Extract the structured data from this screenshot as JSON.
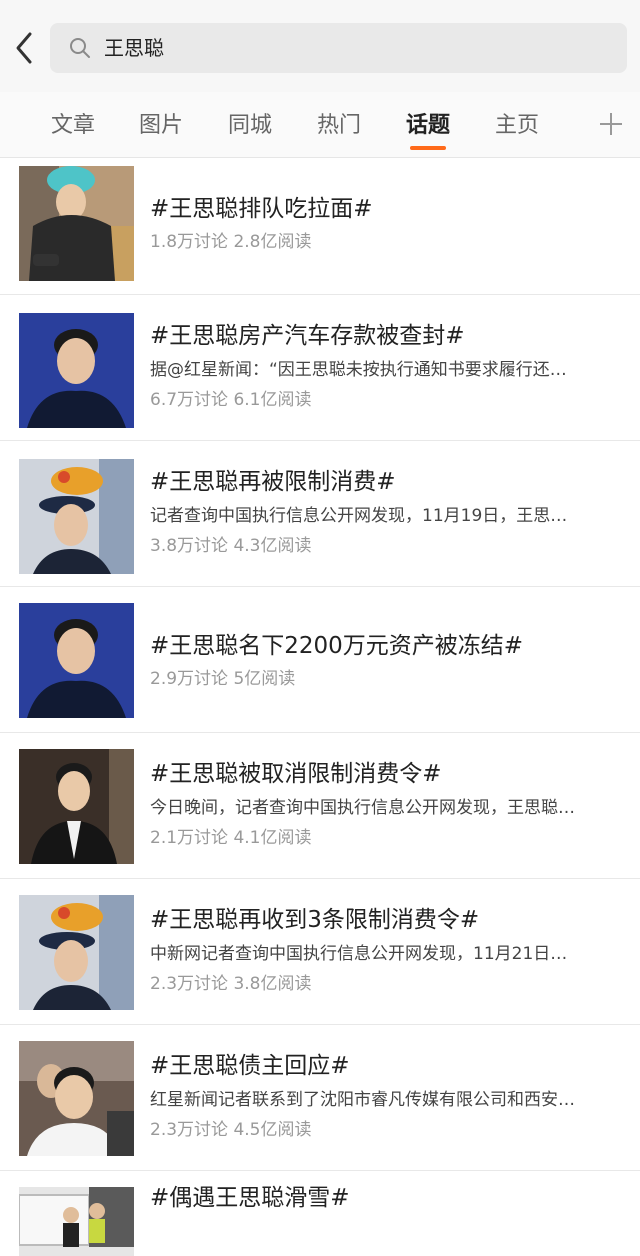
{
  "header": {
    "back_icon": "back-arrow-icon",
    "search_icon": "search-icon",
    "search_query": "王思聪"
  },
  "tabs": [
    {
      "label": "文章",
      "active": false
    },
    {
      "label": "图片",
      "active": false
    },
    {
      "label": "同城",
      "active": false
    },
    {
      "label": "热门",
      "active": false
    },
    {
      "label": "话题",
      "active": true
    },
    {
      "label": "主页",
      "active": false
    }
  ],
  "add_tab_icon": "plus-icon",
  "accent_color": "#ff6a1a",
  "topics": [
    {
      "title": "#王思聪排队吃拉面#",
      "desc": "",
      "stats": "1.8万讨论 2.8亿阅读"
    },
    {
      "title": "#王思聪房产汽车存款被查封#",
      "desc": "据@红星新闻：“因王思聪未按执行通知书要求履行还…",
      "stats": "6.7万讨论 6.1亿阅读"
    },
    {
      "title": "#王思聪再被限制消费#",
      "desc": "记者查询中国执行信息公开网发现，11月19日，王思…",
      "stats": "3.8万讨论 4.3亿阅读"
    },
    {
      "title": "#王思聪名下2200万元资产被冻结#",
      "desc": "",
      "stats": "2.9万讨论 5亿阅读"
    },
    {
      "title": "#王思聪被取消限制消费令#",
      "desc": "今日晚间，记者查询中国执行信息公开网发现，王思聪…",
      "stats": "2.1万讨论 4.1亿阅读"
    },
    {
      "title": "#王思聪再收到3条限制消费令#",
      "desc": "中新网记者查询中国执行信息公开网发现，11月21日…",
      "stats": "2.3万讨论 3.8亿阅读"
    },
    {
      "title": "#王思聪债主回应#",
      "desc": "红星新闻记者联系到了沈阳市睿凡传媒有限公司和西安…",
      "stats": "2.3万讨论 4.5亿阅读"
    },
    {
      "title": "#偶遇王思聪滑雪#",
      "desc": "",
      "stats": ""
    }
  ]
}
